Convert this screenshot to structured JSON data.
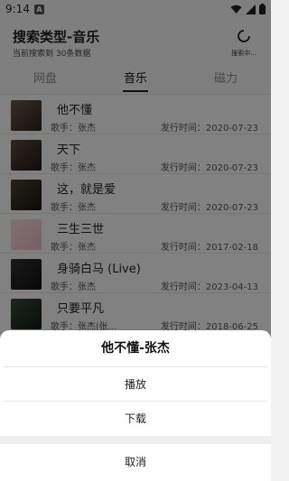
{
  "status_bar": {
    "time": "9:14",
    "app_badge": "A"
  },
  "header": {
    "title": "搜索类型-音乐",
    "subtitle": "当前搜索到 30条数据",
    "status_text": "搜索中..."
  },
  "tabs": [
    {
      "label": "网盘"
    },
    {
      "label": "音乐"
    },
    {
      "label": "磁力"
    }
  ],
  "songs": [
    {
      "name": "他不懂",
      "singer": "歌手：张杰",
      "date": "发行时间：2020-07-23"
    },
    {
      "name": "天下",
      "singer": "歌手：张杰",
      "date": "发行时间：2020-07-23"
    },
    {
      "name": "这，就是爱",
      "singer": "歌手：张杰",
      "date": "发行时间：2020-07-23"
    },
    {
      "name": "三生三世",
      "singer": "歌手：张杰",
      "date": "发行时间：2017-02-18"
    },
    {
      "name": "身骑白马 (Live)",
      "singer": "歌手：张杰",
      "date": "发行时间：2023-04-13"
    },
    {
      "name": "只要平凡",
      "singer": "歌手：张杰|张...",
      "date": "发行时间：2018-06-25"
    }
  ],
  "sheet": {
    "title": "他不懂-张杰",
    "play_label": "播放",
    "download_label": "下载",
    "cancel_label": "取消"
  }
}
